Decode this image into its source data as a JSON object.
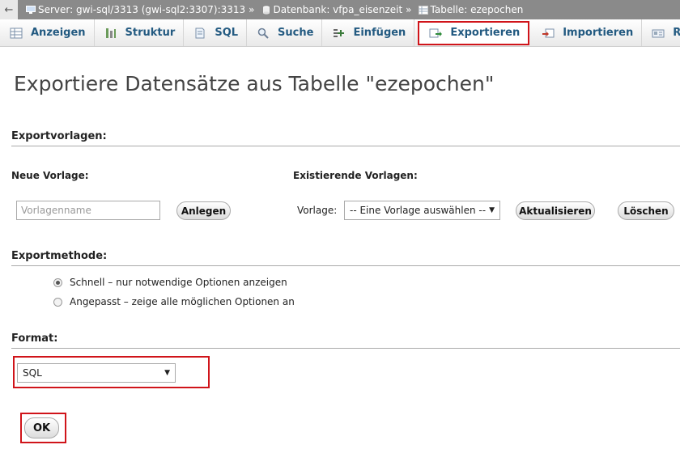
{
  "breadcrumb": {
    "back_glyph": "←",
    "server": "Server: gwi-sql/3313 (gwi-sql2:3307):3313",
    "database": "Datenbank: vfpa_eisenzeit",
    "table": "Tabelle: ezepochen",
    "separator": "»"
  },
  "tabs": [
    {
      "label": "Anzeigen",
      "icon": "table-browse-icon"
    },
    {
      "label": "Struktur",
      "icon": "structure-icon"
    },
    {
      "label": "SQL",
      "icon": "sql-icon"
    },
    {
      "label": "Suche",
      "icon": "search-icon"
    },
    {
      "label": "Einfügen",
      "icon": "insert-icon"
    },
    {
      "label": "Exportieren",
      "icon": "export-icon"
    },
    {
      "label": "Importieren",
      "icon": "import-icon"
    },
    {
      "label": "Rechte",
      "icon": "privileges-icon"
    },
    {
      "label": "",
      "icon": "wrench-icon"
    }
  ],
  "page_title": "Exportiere Datensätze aus Tabelle \"ezepochen\"",
  "templates": {
    "heading": "Exportvorlagen:",
    "new_label": "Neue Vorlage:",
    "name_placeholder": "Vorlagenname",
    "create_button": "Anlegen",
    "existing_label": "Existierende Vorlagen:",
    "template_label": "Vorlage:",
    "template_select": "-- Eine Vorlage auswählen --",
    "update_button": "Aktualisieren",
    "delete_button": "Löschen"
  },
  "method": {
    "heading": "Exportmethode:",
    "option_quick": "Schnell – nur notwendige Optionen anzeigen",
    "option_custom": "Angepasst – zeige alle möglichen Optionen an",
    "selected": "quick"
  },
  "format": {
    "heading": "Format:",
    "selected": "SQL"
  },
  "ok_button": "OK",
  "colors": {
    "highlight": "#d0141a",
    "tab_text": "#235a81",
    "breadcrumb_bg": "#8a8a8a"
  }
}
